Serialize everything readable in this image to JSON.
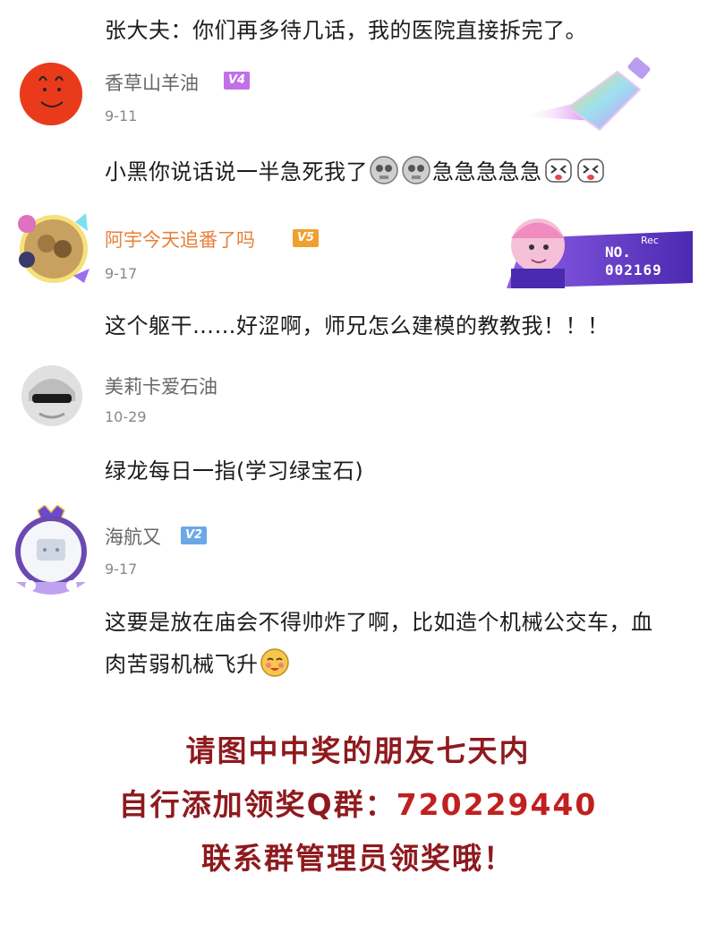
{
  "comments": [
    {
      "text": "张大夫：你们再多待几话，我的医院直接拆完了。"
    },
    {
      "username": "香草山羊油",
      "level": "V4",
      "date": "9-11",
      "text": "小黑你说话说一半急死我了",
      "text_tail": "急急急急急",
      "emojis": [
        "skull-face-emoji",
        "skull-face-emoji",
        "crying-face-emoji",
        "crying-face-emoji"
      ]
    },
    {
      "username": "阿宇今天追番了吗",
      "level": "V5",
      "date": "9-17",
      "text": "这个躯干……好涩啊，师兄怎么建模的教教我！！！",
      "card_no_label": "NO.",
      "card_number": "002169",
      "card_rec": "Rec"
    },
    {
      "username": "美莉卡爱石油",
      "date": "10-29",
      "text": "绿龙每日一指(学习绿宝石)"
    },
    {
      "username": "海航又",
      "level": "V2",
      "date": "9-17",
      "text": "这要是放在庙会不得帅炸了啊，比如造个机械公交车，血肉苦弱机械飞升",
      "emojis": [
        "smug-face-emoji"
      ]
    }
  ],
  "footer": {
    "line1": "请图中中奖的朋友七天内",
    "line2_prefix": "自行添加领奖Q群：",
    "line2_number": "720229440",
    "line3": "联系群管理员领奖哦！"
  },
  "colors": {
    "footer_text": "#8e1a1e",
    "footer_number": "#c0201f",
    "vip_name": "#e8803a",
    "badge_v4": "#c070e8",
    "badge_v5": "#f0a030",
    "badge_v2": "#6aa8e8"
  }
}
